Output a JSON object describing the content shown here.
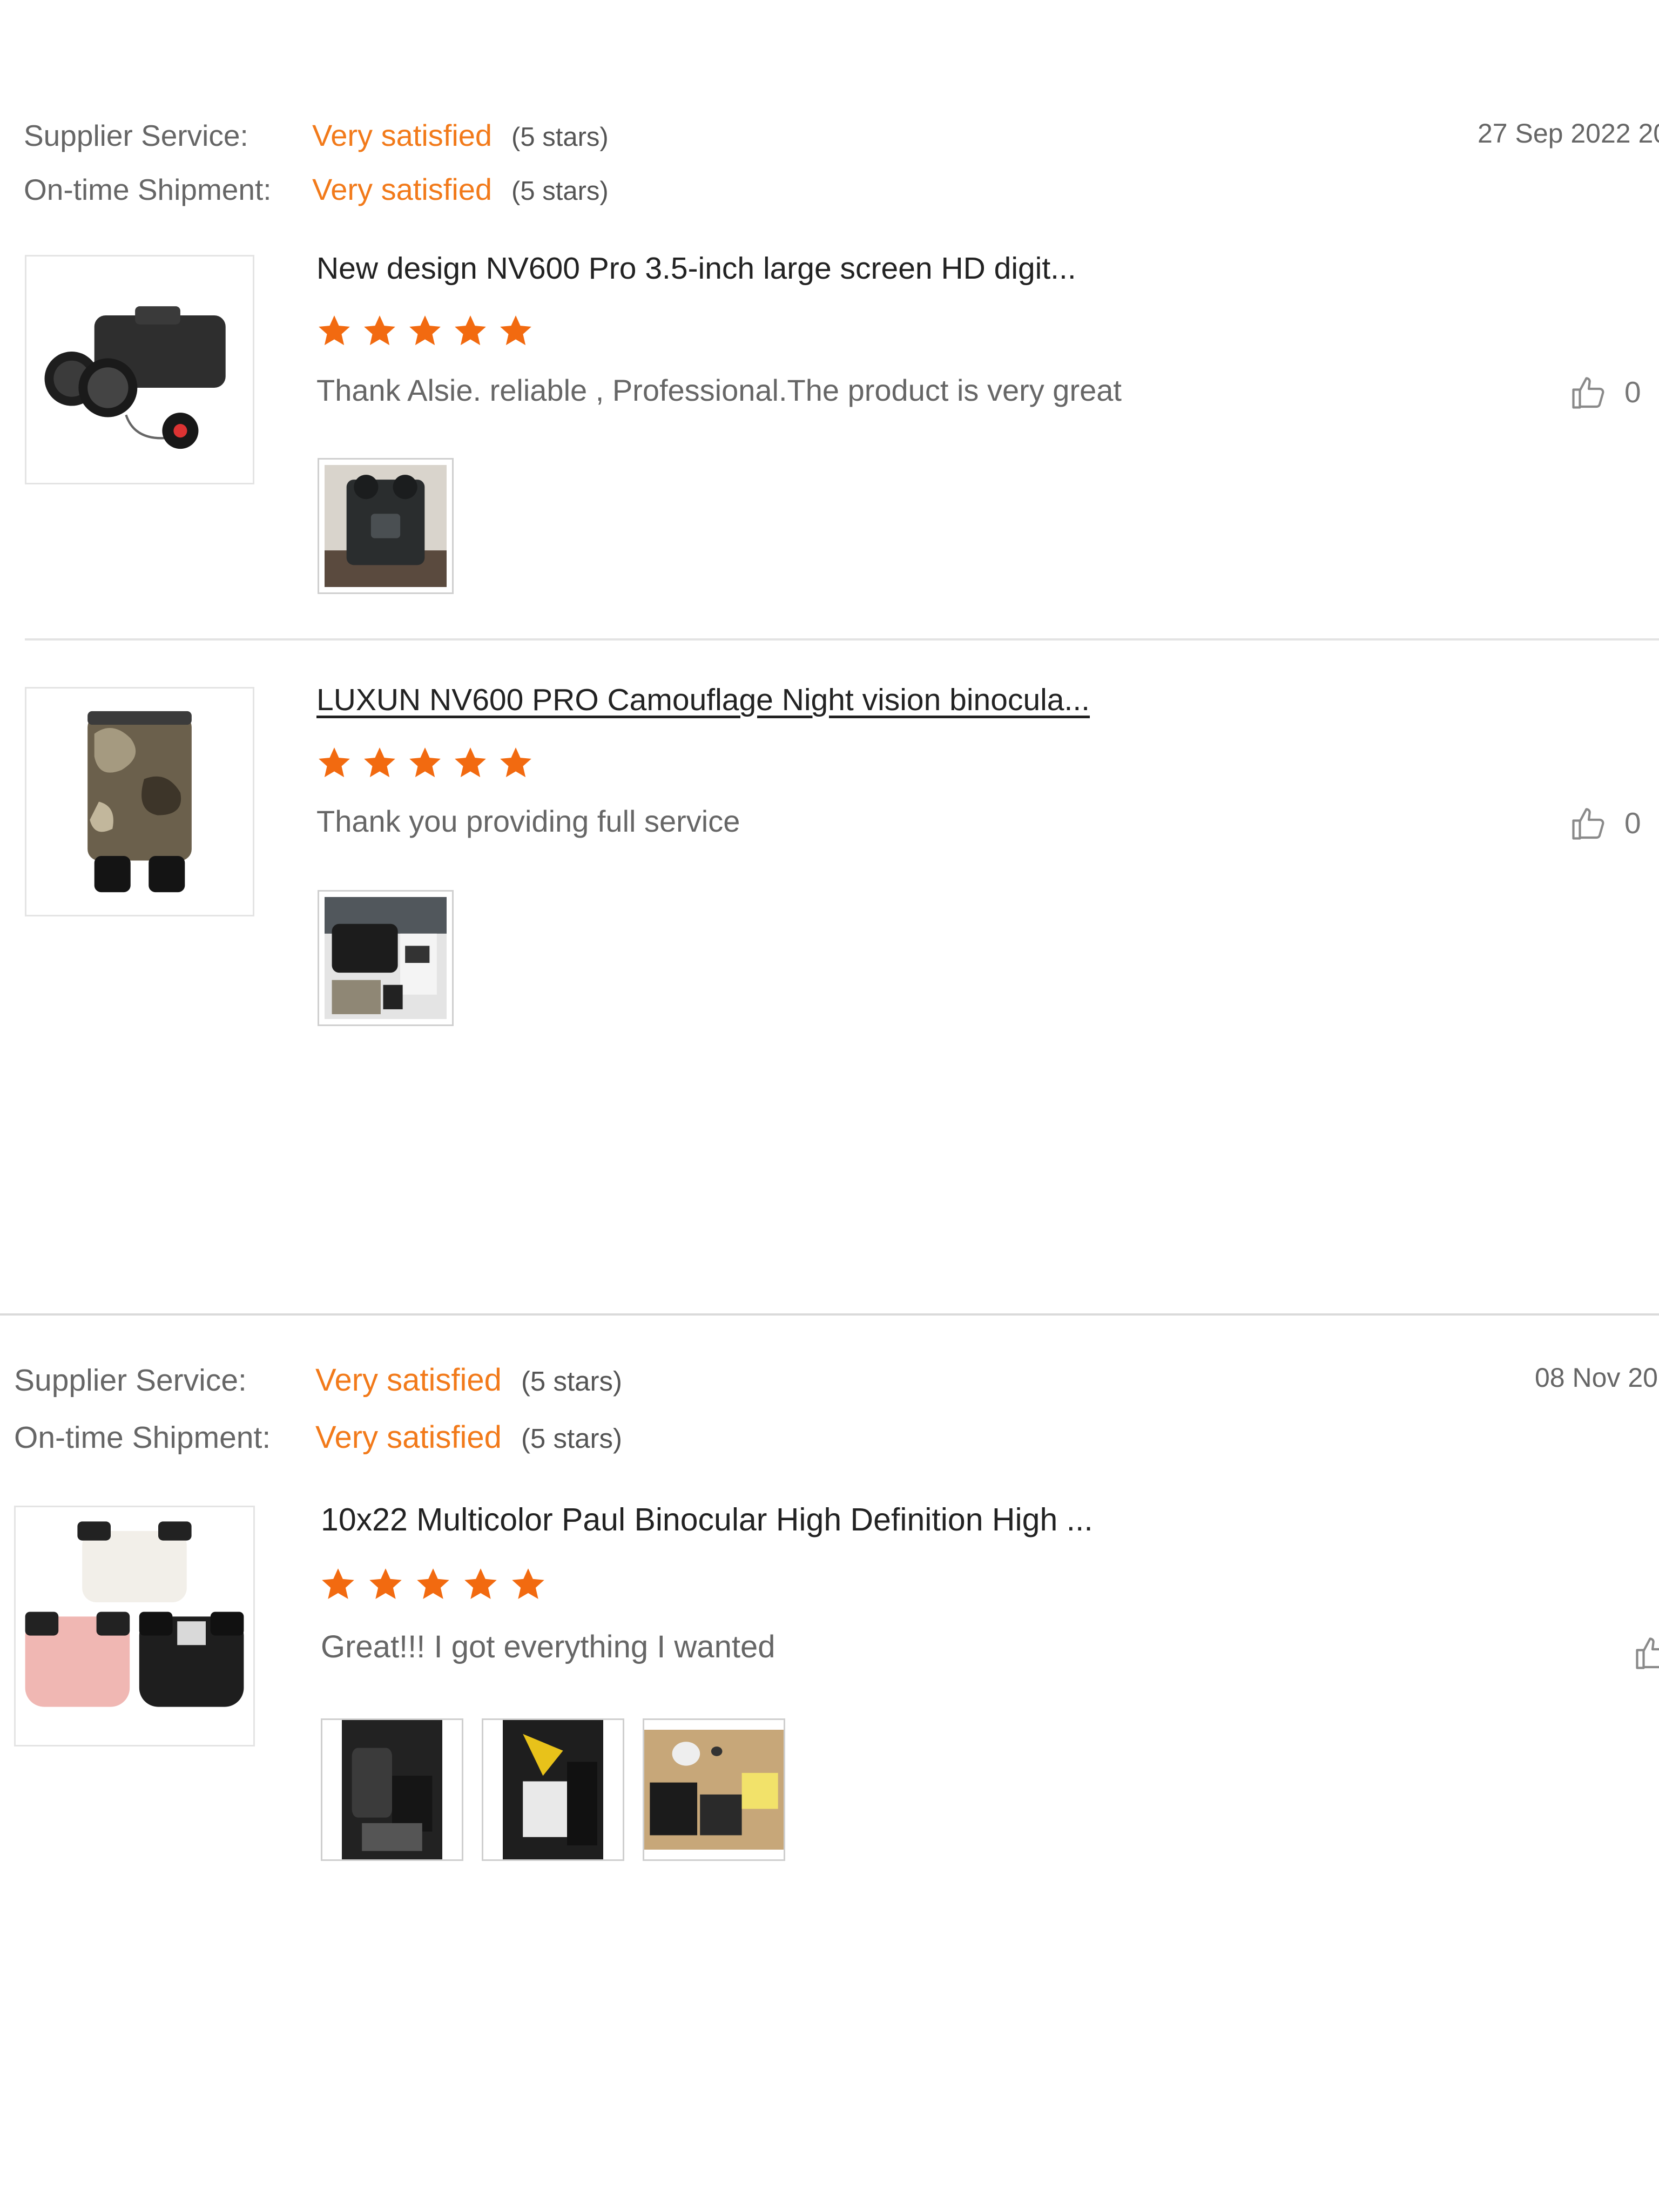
{
  "reviews": [
    {
      "supplier_label": "Supplier Service:",
      "supplier_value": "Very satisfied",
      "supplier_stars": "(5 stars)",
      "shipment_label": "On-time Shipment:",
      "shipment_value": "Very satisfied",
      "shipment_stars": "(5 stars)",
      "date": "27 Sep 2022 20",
      "items": [
        {
          "title": "New design NV600 Pro 3.5-inch large screen HD digit...",
          "rating": 5,
          "comment": "Thank Alsie. reliable  , Professional.The product is very great",
          "likes": "0",
          "photo_count": 1
        },
        {
          "title": "LUXUN NV600 PRO Camouflage Night vision binocula...",
          "rating": 5,
          "comment": "Thank you providing full service",
          "likes": "0",
          "photo_count": 1
        }
      ]
    },
    {
      "supplier_label": "Supplier Service:",
      "supplier_value": "Very satisfied",
      "supplier_stars": "(5 stars)",
      "shipment_label": "On-time Shipment:",
      "shipment_value": "Very satisfied",
      "shipment_stars": "(5 stars)",
      "date": "08 Nov 20",
      "items": [
        {
          "title": "10x22 Multicolor Paul Binocular High Definition High ...",
          "rating": 5,
          "comment": "Great!!!  I got everything I wanted",
          "photo_count": 3
        }
      ]
    }
  ],
  "colors": {
    "accent": "#f27a1a",
    "star": "#f26a10",
    "label": "#666666",
    "title": "#222222"
  },
  "icons": {
    "star": "star-icon",
    "like": "thumbs-up-icon"
  }
}
